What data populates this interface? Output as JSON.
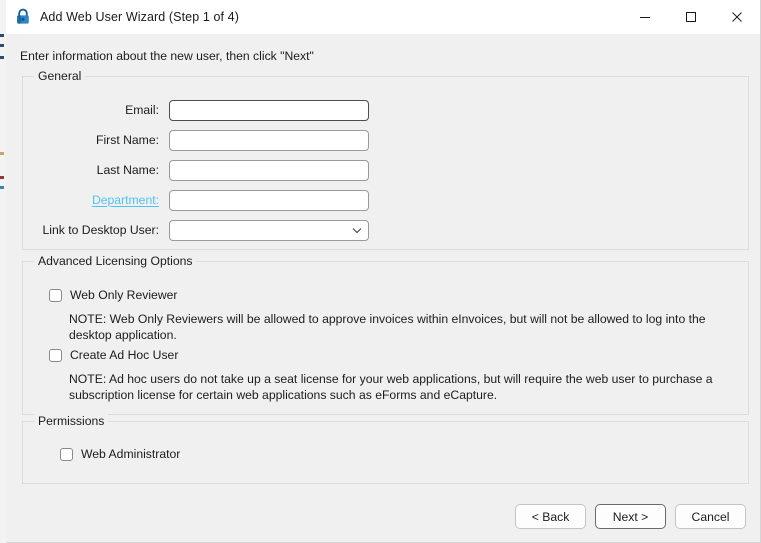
{
  "window": {
    "title": "Add Web User Wizard (Step 1 of 4)",
    "icon": "lock-icon",
    "controls": {
      "minimize": "minimize-icon",
      "maximize": "maximize-icon",
      "close": "close-icon"
    }
  },
  "intro": "Enter information about the new user, then click \"Next\"",
  "general": {
    "legend": "General",
    "fields": [
      {
        "label": "Email:",
        "type": "text",
        "value": "",
        "placeholder": "",
        "focused": true
      },
      {
        "label": "First Name:",
        "type": "text",
        "value": "",
        "placeholder": "",
        "focused": false
      },
      {
        "label": "Last Name:",
        "type": "text",
        "value": "",
        "placeholder": "",
        "focused": false
      },
      {
        "label": "Department:",
        "type": "text",
        "value": "",
        "placeholder": "",
        "focused": false,
        "is_link": true
      },
      {
        "label": "Link to Desktop User:",
        "type": "combo",
        "value": "",
        "placeholder": "",
        "focused": false
      }
    ]
  },
  "advanced": {
    "legend": "Advanced Licensing Options",
    "options": [
      {
        "label": "Web Only Reviewer",
        "checked": false,
        "note": "NOTE: Web Only Reviewers will be allowed to approve invoices within eInvoices, but will not be allowed to log into the desktop application."
      },
      {
        "label": "Create Ad Hoc User",
        "checked": false,
        "note": "NOTE: Ad hoc users do not take up a seat license for your web applications, but will require the web user to purchase a subscription license for certain web applications such as eForms and eCapture."
      }
    ]
  },
  "permissions": {
    "legend": "Permissions",
    "options": [
      {
        "label": "Web Administrator",
        "checked": false
      }
    ]
  },
  "footer": {
    "back": "< Back",
    "next": "Next >",
    "cancel": "Cancel"
  },
  "colors": {
    "link": "#4fc3f3",
    "dialog_bg": "#f0f0f0",
    "titlebar_bg": "#ffffff",
    "group_border": "#dcdcdc",
    "input_border": "#9a9a9a",
    "default_button_border": "#6a6a6a"
  }
}
